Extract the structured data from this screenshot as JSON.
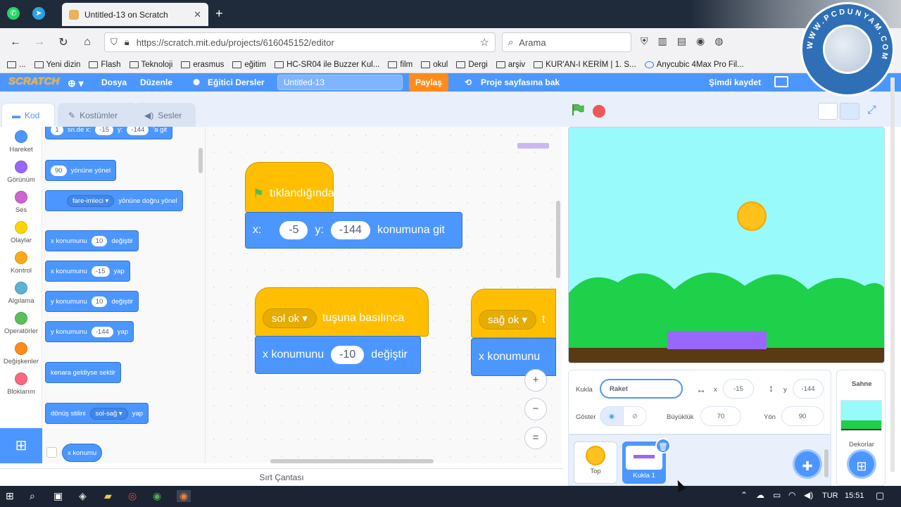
{
  "browser": {
    "tab_title": "Untitled-13 on Scratch",
    "url": "https://scratch.mit.edu/projects/616045152/editor",
    "search_placeholder": "Arama",
    "bookmarks": [
      "...",
      "Yeni dizin",
      "Flash",
      "Teknoloji",
      "erasmus",
      "eğitim",
      "HC-SR04 ile Buzzer Kul...",
      "film",
      "okul",
      "Dergi",
      "arşiv",
      "KUR'AN-I KERİM | 1. S...",
      "Anycubic 4Max Pro Fil..."
    ]
  },
  "watermark": {
    "text": "WWW.PCDUNYAM.COM"
  },
  "menubar": {
    "logo": "SCRATCH",
    "file": "Dosya",
    "edit": "Düzenle",
    "tutorials": "Eğitici Dersler",
    "project_title": "Untitled-13",
    "share": "Paylaş",
    "project_page": "Proje sayfasına bak",
    "save_now": "Şimdi kaydet"
  },
  "editor_tabs": {
    "code": "Kod",
    "costumes": "Kostümler",
    "sounds": "Sesler"
  },
  "categories": [
    {
      "label": "Hareket",
      "color": "#4c97ff"
    },
    {
      "label": "Görünüm",
      "color": "#9966ff"
    },
    {
      "label": "Ses",
      "color": "#cf63cf"
    },
    {
      "label": "Olaylar",
      "color": "#ffd500"
    },
    {
      "label": "Kontrol",
      "color": "#ffab19"
    },
    {
      "label": "Algılama",
      "color": "#5cb1d6"
    },
    {
      "label": "Operatörler",
      "color": "#59c059"
    },
    {
      "label": "Değişkenler",
      "color": "#ff8c1a"
    },
    {
      "label": "Bloklarım",
      "color": "#ff6680"
    }
  ],
  "palette": {
    "glide": {
      "secs": "1",
      "t1": "sn.de x:",
      "x": "-15",
      "t2": "y:",
      "y": "-144",
      "t3": "'a git"
    },
    "point_dir": {
      "val": "90",
      "text": "yönüne yönel"
    },
    "point_towards": {
      "dd": "fare-imleci",
      "text": "yönüne doğru yönel"
    },
    "change_x": {
      "t1": "x konumunu",
      "val": "10",
      "t2": "değiştir"
    },
    "set_x": {
      "t1": "x konumunu",
      "val": "-15",
      "t2": "yap"
    },
    "change_y": {
      "t1": "y konumunu",
      "val": "10",
      "t2": "değiştir"
    },
    "set_y": {
      "t1": "y konumunu",
      "val": "-144",
      "t2": "yap"
    },
    "bounce": "kenara geldiyse sektir",
    "rotation": {
      "t1": "dönüş stilini",
      "dd": "sol-sağ",
      "t2": "yap"
    },
    "xpos": "x konumu"
  },
  "workspace": {
    "script1": {
      "hat": "tıklandığında",
      "x_label": "x:",
      "x": "-5",
      "y_label": "y:",
      "y": "-144",
      "tail": "konumuna git"
    },
    "script2": {
      "key": "sol ok",
      "hat": "tuşuna basılınca",
      "t1": "x konumunu",
      "val": "-10",
      "t2": "değiştir"
    },
    "script3": {
      "key": "sağ ok",
      "hat": "t",
      "t1": "x konumunu"
    },
    "zoom_in": "+",
    "zoom_out": "−",
    "zoom_reset": "="
  },
  "backpack": "Sırt Çantası",
  "sprite_info": {
    "sprite_label": "Kukla",
    "sprite_name": "Raket",
    "x_label": "x",
    "x": "-15",
    "y_label": "y",
    "y": "-144",
    "show_label": "Göster",
    "size_label": "Büyüklük",
    "size": "70",
    "direction_label": "Yön",
    "direction": "90"
  },
  "sprites": [
    {
      "name": "Top"
    },
    {
      "name": "Kukla 1"
    }
  ],
  "stage_panel": {
    "title": "Sahne",
    "backdrops": "Dekorlar"
  },
  "taskbar": {
    "lang": "TUR",
    "time": "15:51"
  }
}
